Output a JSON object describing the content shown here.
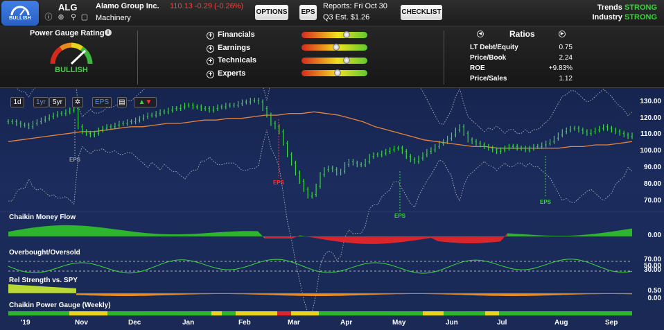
{
  "header": {
    "badge_label": "BULLISH",
    "ticker": "ALG",
    "company": "Alamo Group Inc.",
    "price_change": "110.13 -0.29  (-0.26%)",
    "industry": "Machinery",
    "options_label": "OPTIONS",
    "eps_label": "EPS",
    "reports": "Reports:  Fri Oct 30",
    "estimate": "Q3  Est.  $1.26",
    "checklist_label": "CHECKLIST",
    "trends_label": "Trends",
    "trends_value": "STRONG",
    "industry_label": "Industry",
    "industry_value": "STRONG"
  },
  "gauge": {
    "title": "Power Gauge Rating",
    "rating": "BULLISH",
    "factors": [
      {
        "label": "Financials",
        "level": 0.71
      },
      {
        "label": "Earnings",
        "level": 0.53
      },
      {
        "label": "Technicals",
        "level": 0.7
      },
      {
        "label": "Experts",
        "level": 0.55
      }
    ]
  },
  "ratios": {
    "title": "Ratios",
    "rows": [
      {
        "label": "LT Debt/Equity",
        "value": "0.75"
      },
      {
        "label": "Price/Book",
        "value": "2.24"
      },
      {
        "label": "ROE",
        "value": "+9.83%"
      },
      {
        "label": "Price/Sales",
        "value": "1.12"
      }
    ]
  },
  "chart_toolbar": {
    "btn_1d": "1d",
    "btn_1yr": "1yr",
    "btn_5yr": "5yr",
    "btn_eps": "EPS"
  },
  "chart_data": {
    "type": "line",
    "price_ylabels": [
      "130.00",
      "120.00",
      "110.00",
      "100.00",
      "90.00",
      "80.00",
      "70.00"
    ],
    "price_ylim": [
      70,
      130
    ],
    "x_labels": [
      "'19",
      "Nov",
      "Dec",
      "Jan",
      "Feb",
      "Mar",
      "Apr",
      "May",
      "Jun",
      "Jul",
      "Aug",
      "Sep"
    ],
    "sections": {
      "money_flow": {
        "title": "Chaikin Money Flow",
        "ylabel": "0.00"
      },
      "overbought": {
        "title": "Overbought/Oversold",
        "ylabels": [
          "70.00",
          "50.00",
          "30.00"
        ]
      },
      "rel_strength": {
        "title": "Rel Strength vs. SPY",
        "ylabels": [
          "0.50",
          "0.00"
        ]
      },
      "power_gauge": {
        "title": "Chaikin Power Gauge (Weekly)"
      }
    },
    "eps_markers": [
      {
        "label": "EPS",
        "color": "#9aa0b0",
        "month": "Nov"
      },
      {
        "label": "EPS",
        "color": "#ff3030",
        "month": "Mar"
      },
      {
        "label": "EPS",
        "color": "#3ad83a",
        "month": "May"
      },
      {
        "label": "EPS",
        "color": "#3ad83a",
        "month": "Aug"
      }
    ],
    "price_series": [
      118,
      118,
      117,
      116,
      116,
      115,
      117,
      118,
      119,
      120,
      121,
      122,
      123,
      123,
      124,
      125,
      126,
      115,
      112,
      111,
      110,
      111,
      113,
      114,
      115,
      115,
      116,
      117,
      117,
      118,
      118,
      119,
      120,
      121,
      122,
      122,
      123,
      124,
      124,
      125,
      126,
      126,
      127,
      128,
      128,
      127,
      127,
      126,
      126,
      125,
      126,
      127,
      127,
      128,
      128,
      128,
      129,
      130,
      130,
      131,
      131,
      130,
      126,
      122,
      117,
      115,
      112,
      105,
      98,
      93,
      87,
      82,
      77,
      73,
      74,
      79,
      86,
      89,
      90,
      89,
      87,
      88,
      92,
      94,
      93,
      92,
      92,
      94,
      97,
      98,
      98,
      99,
      100,
      101,
      102,
      102,
      100,
      97,
      95,
      94,
      96,
      98,
      100,
      101,
      103,
      105,
      106,
      108,
      110,
      113,
      115,
      111,
      107,
      106,
      105,
      104,
      103,
      102,
      101,
      100,
      101,
      102,
      103,
      103,
      102,
      102,
      101,
      102,
      103,
      103,
      104,
      105,
      106,
      108,
      110,
      112,
      113,
      114,
      114,
      113,
      112,
      111,
      112,
      113,
      114,
      115,
      114,
      113,
      112,
      111,
      110,
      109,
      110
    ],
    "ma_series": [
      106,
      107,
      108,
      109,
      110,
      111,
      112,
      112,
      113,
      114,
      115,
      115,
      116,
      117,
      117,
      118,
      119,
      119,
      120,
      120,
      121,
      122,
      122,
      123,
      123,
      124,
      123,
      122,
      120,
      118,
      115,
      113,
      111,
      109,
      107,
      106,
      105,
      104,
      103,
      103,
      102,
      102,
      102,
      102,
      102,
      102,
      103,
      103,
      104,
      104,
      105,
      106
    ]
  }
}
